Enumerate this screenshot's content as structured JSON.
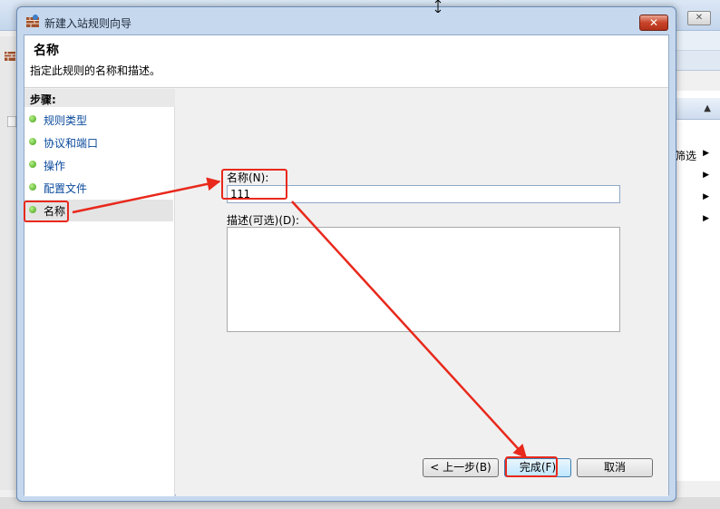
{
  "dialog": {
    "title": "新建入站规则向导",
    "close_label": "✕"
  },
  "header": {
    "title": "名称",
    "description": "指定此规则的名称和描述。"
  },
  "steps": {
    "heading": "步骤:",
    "items": [
      {
        "label": "规则类型"
      },
      {
        "label": "协议和端口"
      },
      {
        "label": "操作"
      },
      {
        "label": "配置文件"
      },
      {
        "label": "名称"
      }
    ],
    "current_index": 4
  },
  "form": {
    "name_label": "名称(N):",
    "name_value": "111",
    "desc_label": "描述(可选)(D):",
    "desc_value": ""
  },
  "buttons": {
    "back": "< 上一步(B)",
    "finish": "完成(F)",
    "cancel": "取消"
  },
  "background": {
    "close_label": "✕",
    "action_label": "筛选"
  },
  "colors": {
    "annotation": "#e8291c",
    "step_link": "#0a4a9c",
    "step_dot": "#3ea012"
  }
}
